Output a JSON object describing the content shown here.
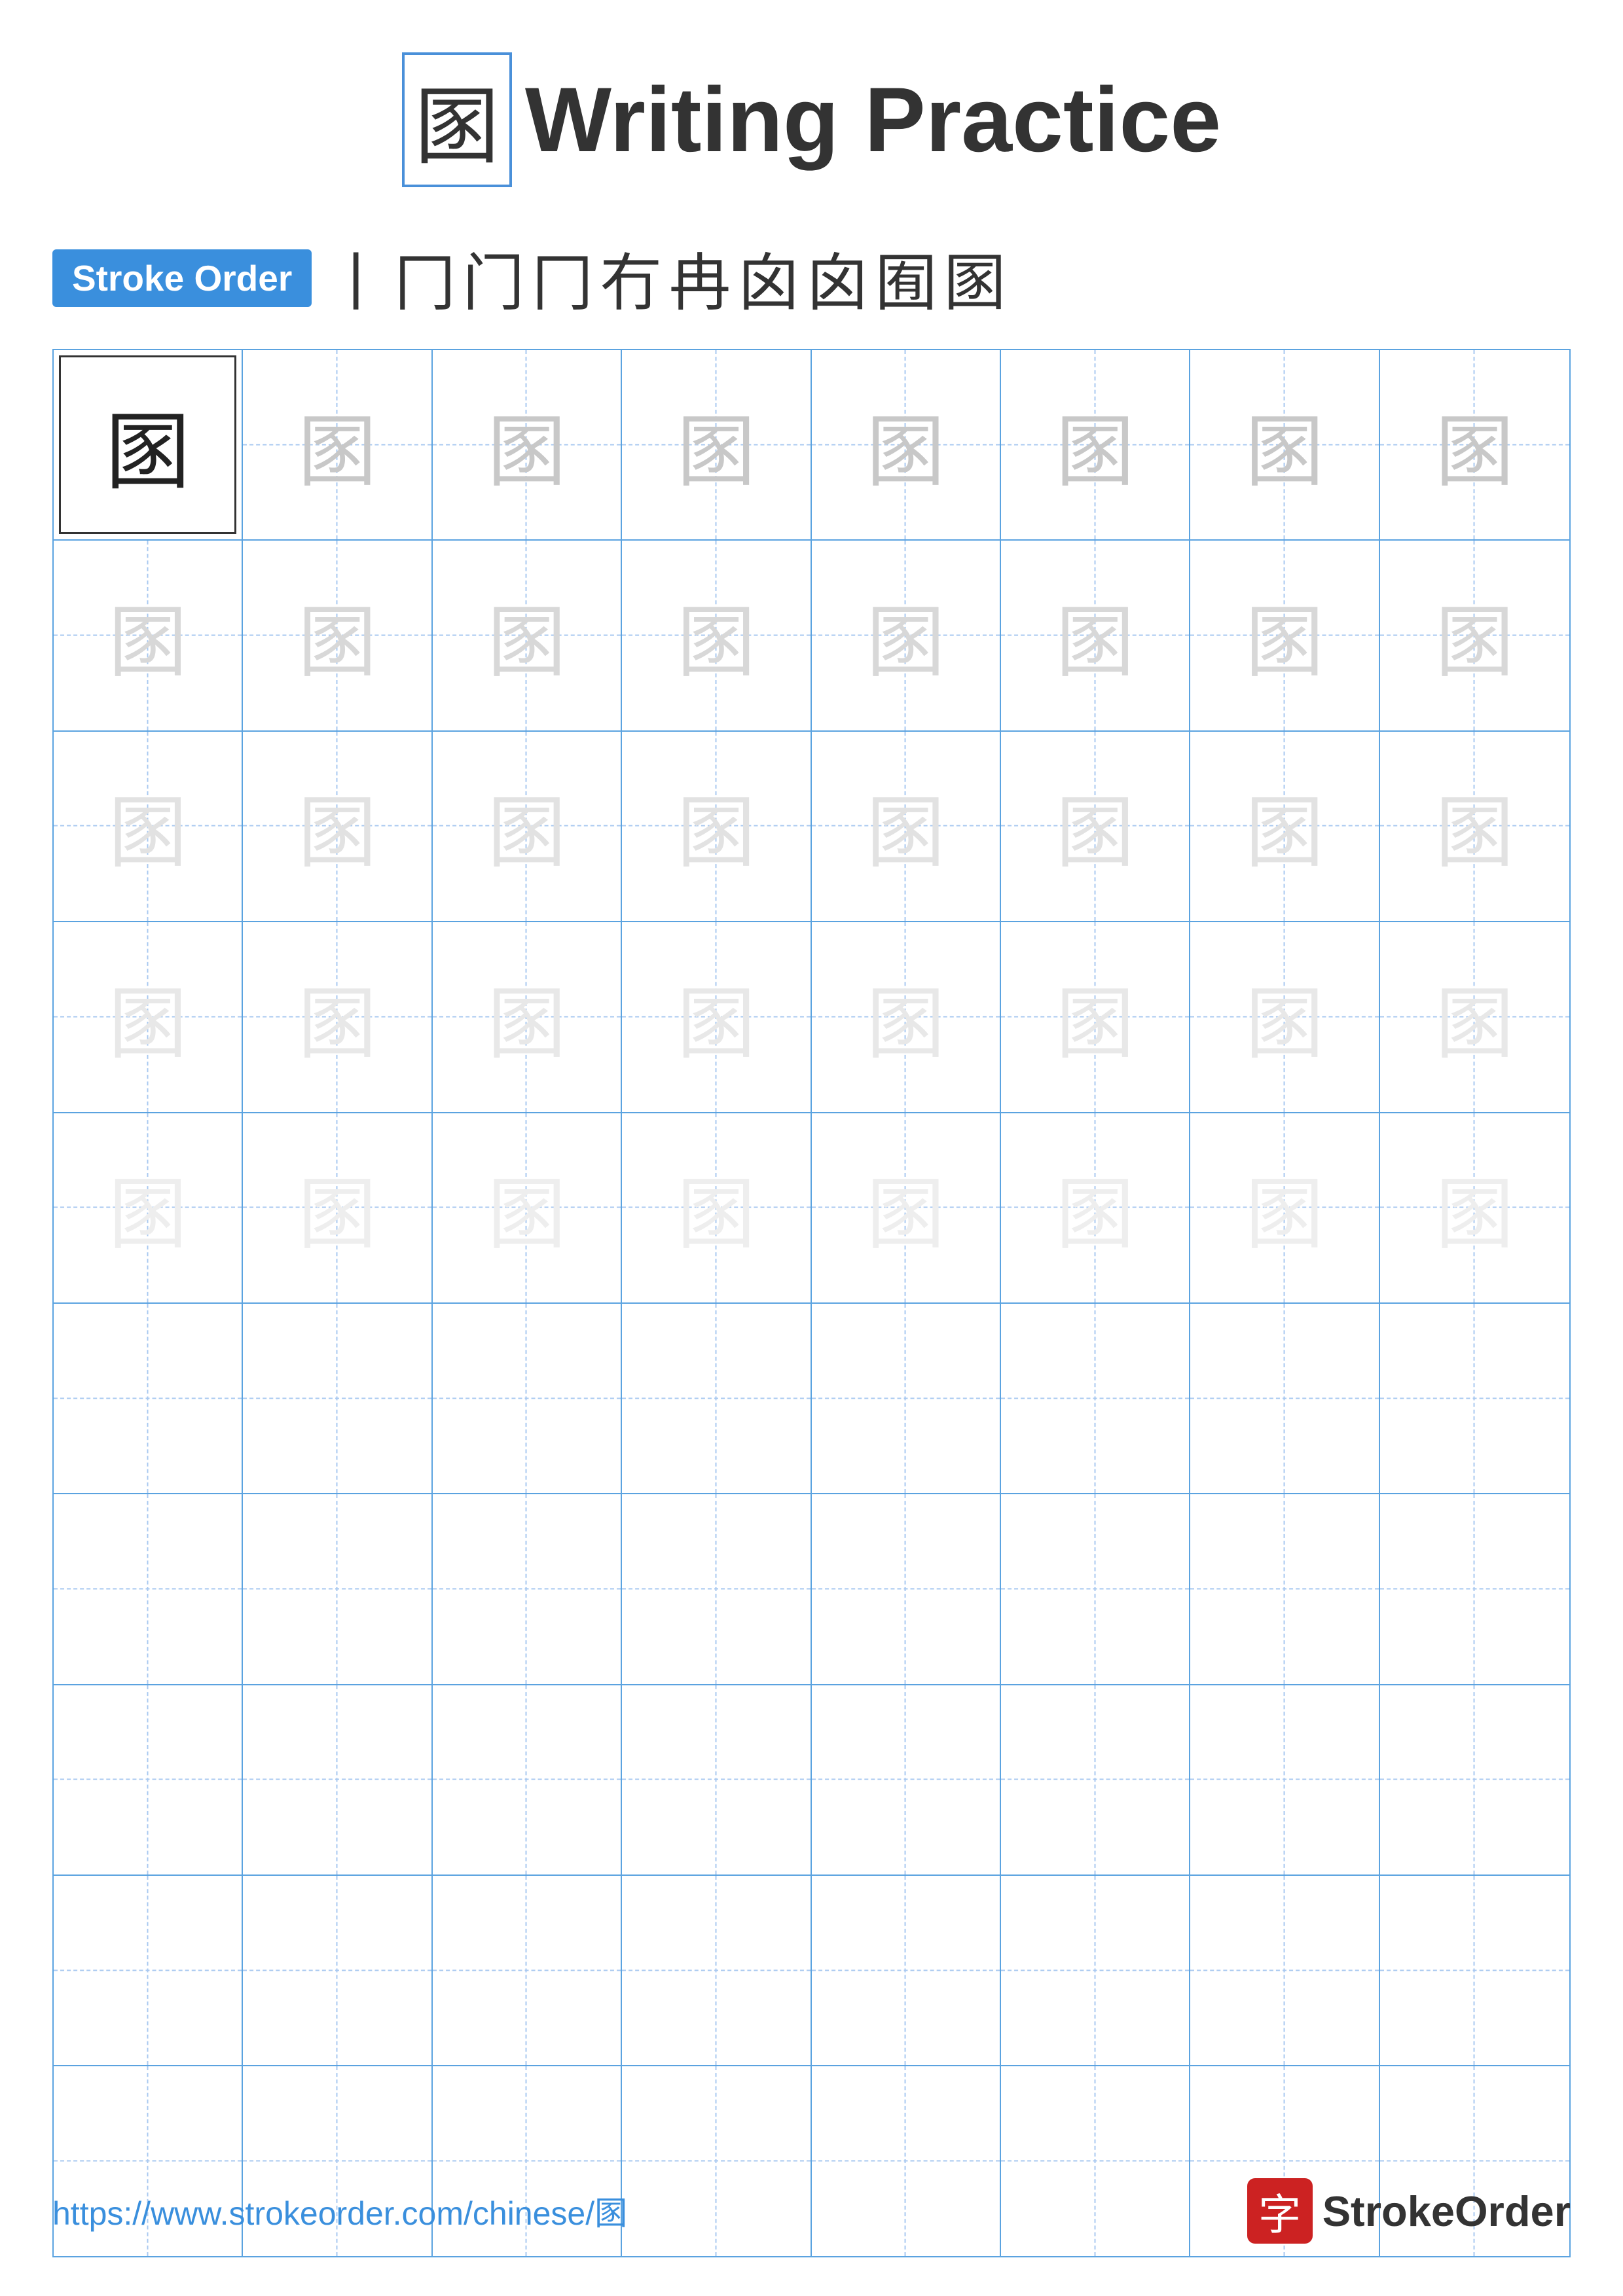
{
  "page": {
    "title_char": "圂",
    "title_text": "Writing Practice",
    "stroke_order_label": "Stroke Order",
    "stroke_sequence": [
      "丨",
      "冂",
      "门",
      "冂",
      "冇",
      "冉",
      "冉",
      "囟",
      "囟",
      "圂"
    ],
    "character": "圂",
    "grid_rows": 10,
    "grid_cols": 8,
    "practice_rows": 5,
    "blank_rows": 5,
    "footer_url": "https://www.strokeorder.com/chinese/圂",
    "footer_logo_char": "字",
    "footer_logo_text": "StrokeOrder"
  }
}
